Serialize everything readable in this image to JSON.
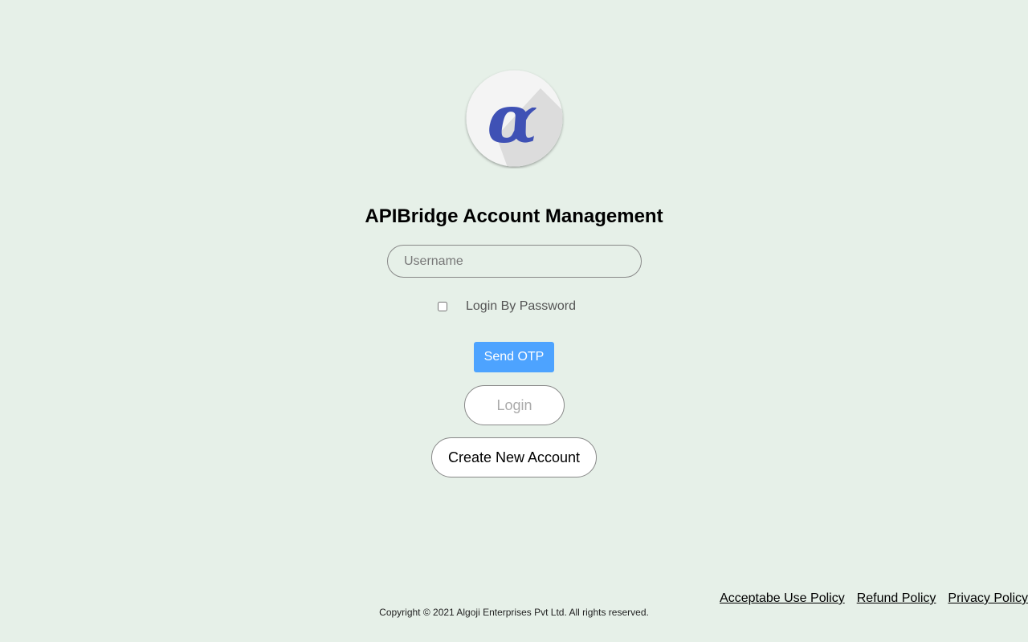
{
  "logo": {
    "icon": "alpha-icon",
    "glyph": "α",
    "color": "#3f51b5"
  },
  "title": "APIBridge Account Management",
  "form": {
    "username_placeholder": "Username",
    "username_value": "",
    "login_by_password_label": "Login By Password",
    "login_by_password_checked": false,
    "send_otp_label": "Send OTP",
    "login_label": "Login",
    "create_account_label": "Create New Account"
  },
  "footer": {
    "links": [
      "Acceptabe Use Policy",
      "Refund Policy",
      "Privacy Policy"
    ],
    "copyright": "Copyright © 2021 Algoji Enterprises Pvt Ltd. All rights reserved."
  },
  "colors": {
    "background": "#e6f0e8",
    "accent": "#4da3ff",
    "logo": "#3f51b5"
  }
}
